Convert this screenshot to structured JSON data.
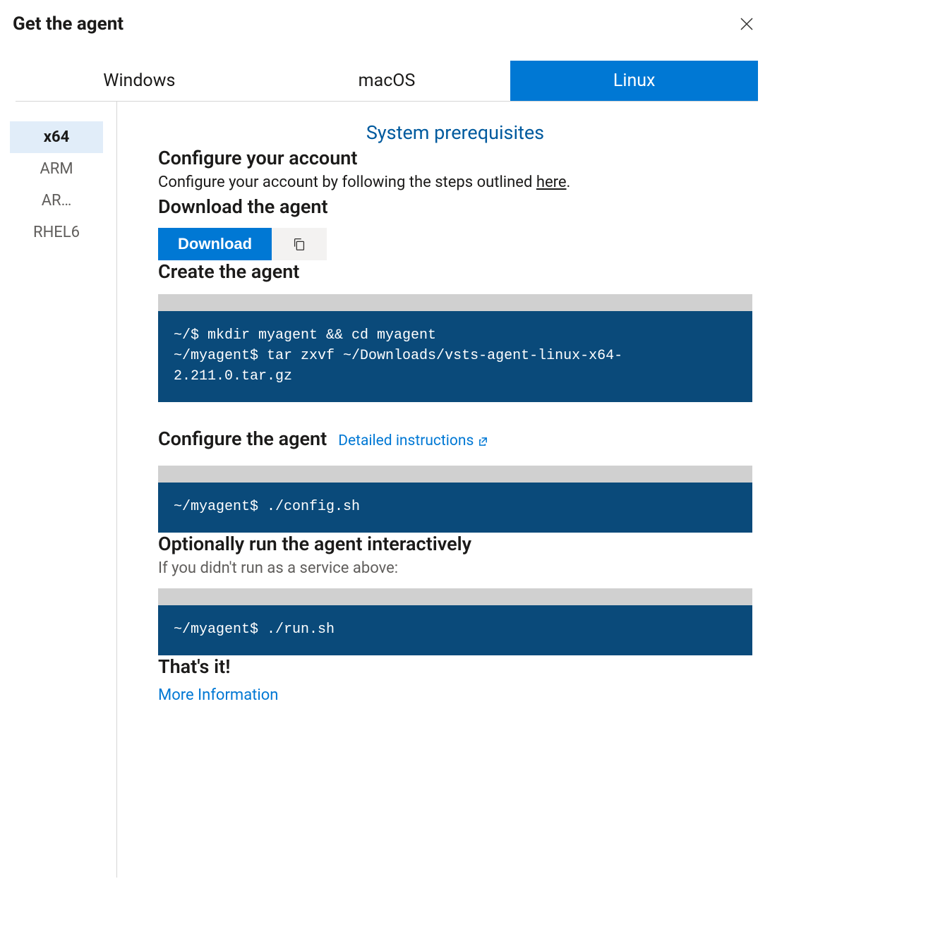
{
  "header": {
    "title": "Get the agent"
  },
  "tabs": [
    {
      "label": "Windows"
    },
    {
      "label": "macOS"
    },
    {
      "label": "Linux",
      "selected": true
    }
  ],
  "sidebar": {
    "items": [
      {
        "label": "x64",
        "selected": true
      },
      {
        "label": "ARM"
      },
      {
        "label": "AR…"
      },
      {
        "label": "RHEL6"
      }
    ]
  },
  "content": {
    "prereq_link": "System prerequisites",
    "configure_account": {
      "heading": "Configure your account",
      "text_prefix": "Configure your account by following the steps outlined ",
      "link_text": "here",
      "text_suffix": "."
    },
    "download": {
      "heading": "Download the agent",
      "button": "Download"
    },
    "create": {
      "heading": "Create the agent",
      "code": "~/$ mkdir myagent && cd myagent\n~/myagent$ tar zxvf ~/Downloads/vsts-agent-linux-x64-2.211.0.tar.gz"
    },
    "configure_agent": {
      "heading": "Configure the agent",
      "link": "Detailed instructions",
      "code": "~/myagent$ ./config.sh"
    },
    "optional_run": {
      "heading": "Optionally run the agent interactively",
      "subtext": "If you didn't run as a service above:",
      "code": "~/myagent$ ./run.sh"
    },
    "thatsit": {
      "heading": "That's it!",
      "link": "More Information"
    }
  }
}
